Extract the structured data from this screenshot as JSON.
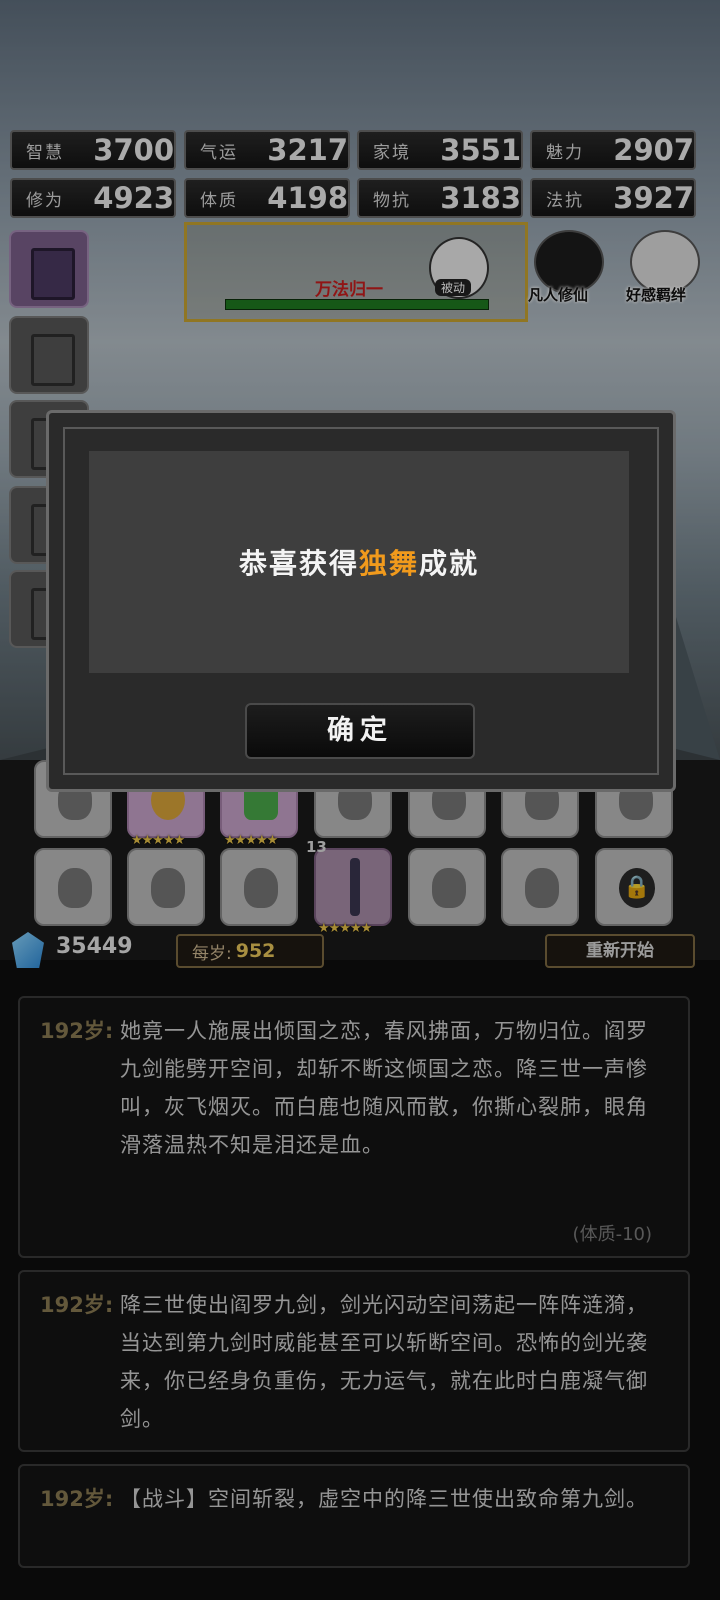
{
  "stats": [
    {
      "label": "智慧",
      "value": "3700"
    },
    {
      "label": "气运",
      "value": "3217"
    },
    {
      "label": "家境",
      "value": "3551"
    },
    {
      "label": "魅力",
      "value": "2907"
    },
    {
      "label": "修为",
      "value": "4923"
    },
    {
      "label": "体质",
      "value": "4198"
    },
    {
      "label": "物抗",
      "value": "3183"
    },
    {
      "label": "法抗",
      "value": "3927"
    }
  ],
  "boss": {
    "name": "万法归一",
    "icon_label": "被动",
    "hp_fraction": 1.0
  },
  "top_icons": [
    {
      "label": "凡人修仙",
      "icon": "mortal-cultivation-icon"
    },
    {
      "label": "好感羁绊",
      "icon": "affinity-bond-icon"
    }
  ],
  "inventory": {
    "badge_count": "13",
    "stars": "★★★★★"
  },
  "currency": {
    "amount": "35449",
    "per_year_label": "每岁:",
    "per_year_value": "952"
  },
  "restart_label": "重新开始",
  "log": [
    {
      "age": "192岁:",
      "text": "她竟一人施展出倾国之恋，春风拂面，万物归位。阎罗九剑能劈开空间，却斩不断这倾国之恋。降三世一声惨叫，灰飞烟灭。而白鹿也随风而散，你撕心裂肺，眼角滑落温热不知是泪还是血。",
      "modifier": "(体质-10)"
    },
    {
      "age": "192岁:",
      "text": "降三世使出阎罗九剑，剑光闪动空间荡起一阵阵涟漪，当达到第九剑时威能甚至可以斩断空间。恐怖的剑光袭来，你已经身负重伤，无力运气，就在此时白鹿凝气御剑。"
    },
    {
      "age": "192岁:",
      "text": "【战斗】空间斩裂，虚空中的降三世使出致命第九剑。"
    }
  ],
  "dialog": {
    "prefix": "恭喜获得",
    "highlight": "独舞",
    "suffix": "成就",
    "confirm_label": "确定"
  },
  "colors": {
    "highlight": "#f19a1c",
    "boss_name": "#c81e1e",
    "hp_bar": "#1f7a21",
    "gold_frame": "#c8a431"
  }
}
